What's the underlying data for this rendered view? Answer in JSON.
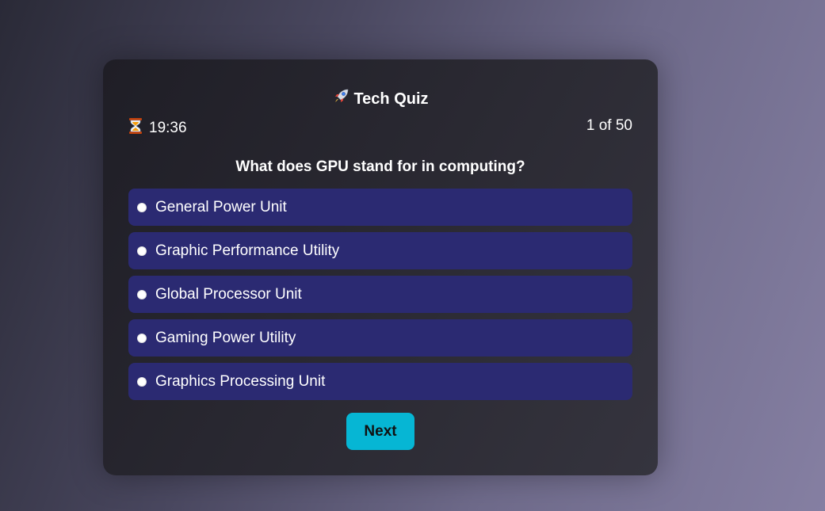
{
  "quiz": {
    "title": "Tech Quiz",
    "title_icon": "rocket-icon",
    "timer": "19:36",
    "timer_icon": "hourglass-icon",
    "progress": "1 of 50",
    "question": "What does GPU stand for in computing?",
    "options": [
      {
        "label": "General Power Unit",
        "selected": false
      },
      {
        "label": "Graphic Performance Utility",
        "selected": false
      },
      {
        "label": "Global Processor Unit",
        "selected": false
      },
      {
        "label": "Gaming Power Utility",
        "selected": false
      },
      {
        "label": "Graphics Processing Unit",
        "selected": false
      }
    ],
    "next_label": "Next"
  },
  "colors": {
    "option_bg": "#2b2a72",
    "button_bg": "#06b6d4",
    "card_bg": "#2a2932"
  }
}
